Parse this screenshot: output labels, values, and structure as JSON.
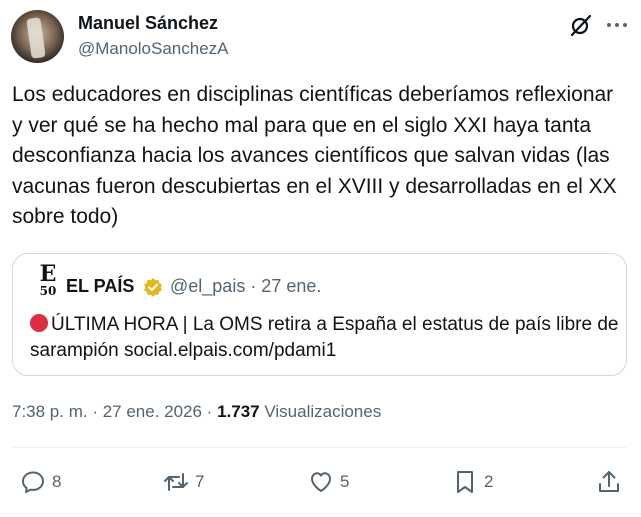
{
  "author": {
    "name": "Manuel Sánchez",
    "handle": "@ManoloSanchezA"
  },
  "tweet": {
    "text": "Los educadores en disciplinas científicas deberíamos reflexionar y ver qué se ha hecho mal para que en el siglo XXI haya tanta desconfianza hacia los avances científicos que salvan vidas (las vacunas fueron descubiertas en el XVIII y desarrolladas en el XX sobre todo)"
  },
  "quote": {
    "logo_letter": "E",
    "logo_number": "50",
    "name": "EL PAÍS",
    "handle_date": "@el_pais · 27 ene.",
    "text": "ÚLTIMA HORA | La OMS retira a España el estatus de país libre de sarampión social.elpais.com/pdami1"
  },
  "meta": {
    "time_date": "7:38 p. m. · 27 ene. 2026 · ",
    "views_count": "1.737",
    "views_label": " Visualizaciones"
  },
  "actions": {
    "replies": "8",
    "reposts": "7",
    "likes": "5",
    "bookmarks": "2"
  },
  "colors": {
    "text": "#0f1419",
    "secondary": "#536471",
    "border": "#cfd9de",
    "verified_gold": "#e2b719",
    "breaking_red": "#dd2e44"
  }
}
